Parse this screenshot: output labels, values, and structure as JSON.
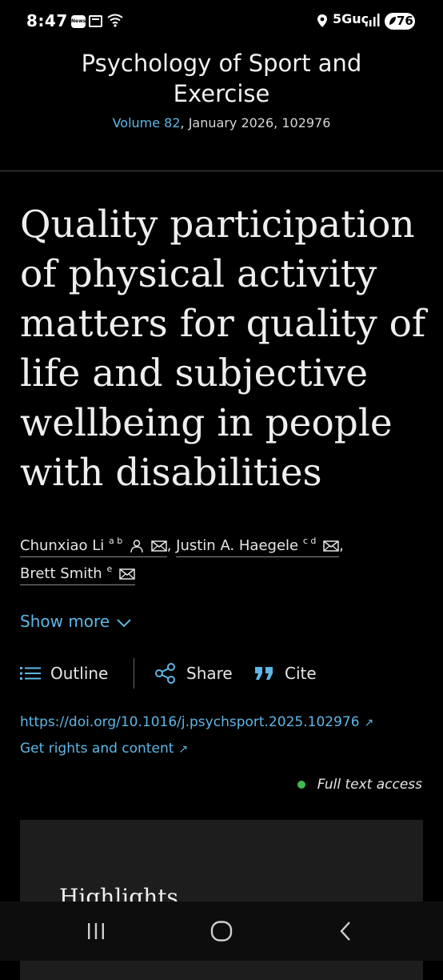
{
  "status_bar": {
    "time": "8:47",
    "news_icon_text": "News",
    "network": "5Guc",
    "battery": "76"
  },
  "journal": {
    "name": "Psychology of Sport and Exercise",
    "volume_link": "Volume 82",
    "volume_rest": ", January 2026, 102976"
  },
  "article": {
    "title": "Quality participation of physical activity matters for quality of life and subjective wellbeing in people with disabilities"
  },
  "authors": [
    {
      "name": "Chunxiao Li",
      "sup": "a b",
      "separator": ","
    },
    {
      "name": "Justin A. Haegele",
      "sup": "c d",
      "separator": ","
    },
    {
      "name": "Brett Smith",
      "sup": "e",
      "separator": ""
    }
  ],
  "show_more": "Show more",
  "actions": {
    "outline": "Outline",
    "share": "Share",
    "cite": "Cite"
  },
  "links": {
    "doi": "https://doi.org/10.1016/j.psychsport.2025.102976",
    "rights": "Get rights and content"
  },
  "access": "Full text access",
  "highlights": {
    "title": "Highlights"
  },
  "colors": {
    "background": "#000000",
    "link": "#5fb6e6",
    "access_dot": "#3fb950",
    "card": "#1d1d1d"
  },
  "icons": {
    "outline": "list-icon",
    "share": "share-icon",
    "cite": "quote-icon",
    "author_profile": "person-icon",
    "author_email": "envelope-icon",
    "external": "arrow-up-right-icon"
  }
}
